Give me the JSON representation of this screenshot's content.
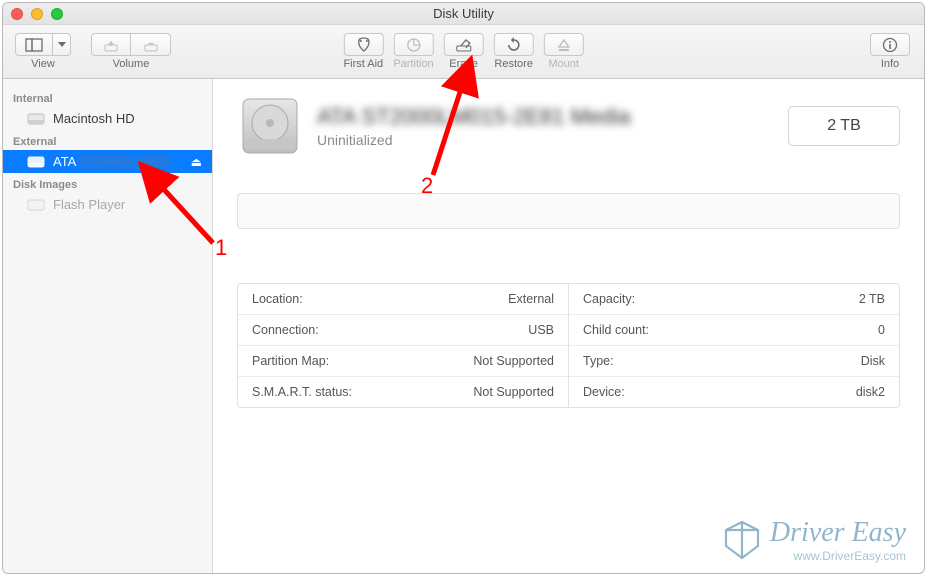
{
  "window": {
    "title": "Disk Utility"
  },
  "toolbar": {
    "view_label": "View",
    "volume_label": "Volume",
    "firstaid_label": "First Aid",
    "partition_label": "Partition",
    "erase_label": "Erase",
    "restore_label": "Restore",
    "mount_label": "Mount",
    "info_label": "Info"
  },
  "sidebar": {
    "sections": [
      {
        "header": "Internal",
        "items": [
          {
            "label": "Macintosh HD",
            "selected": false,
            "eject": false
          }
        ]
      },
      {
        "header": "External",
        "items": [
          {
            "label": "ATA",
            "blurred_suffix": "ST2000LM015",
            "selected": true,
            "eject": true
          }
        ]
      },
      {
        "header": "Disk Images",
        "items": [
          {
            "label": "Flash Player",
            "selected": false,
            "eject": false
          }
        ]
      }
    ]
  },
  "details": {
    "title_blurred": "ATA ST2000LM015-2E81 Media",
    "subtitle": "Uninitialized",
    "capacity_button": "2 TB",
    "rows_left": [
      {
        "label": "Location:",
        "value": "External"
      },
      {
        "label": "Connection:",
        "value": "USB"
      },
      {
        "label": "Partition Map:",
        "value": "Not Supported"
      },
      {
        "label": "S.M.A.R.T. status:",
        "value": "Not Supported"
      }
    ],
    "rows_right": [
      {
        "label": "Capacity:",
        "value": "2 TB"
      },
      {
        "label": "Child count:",
        "value": "0"
      },
      {
        "label": "Type:",
        "value": "Disk"
      },
      {
        "label": "Device:",
        "value": "disk2"
      }
    ]
  },
  "annotations": {
    "marker1": "1",
    "marker2": "2"
  },
  "watermark": {
    "brand": "Driver Easy",
    "url": "www.DriverEasy.com"
  }
}
